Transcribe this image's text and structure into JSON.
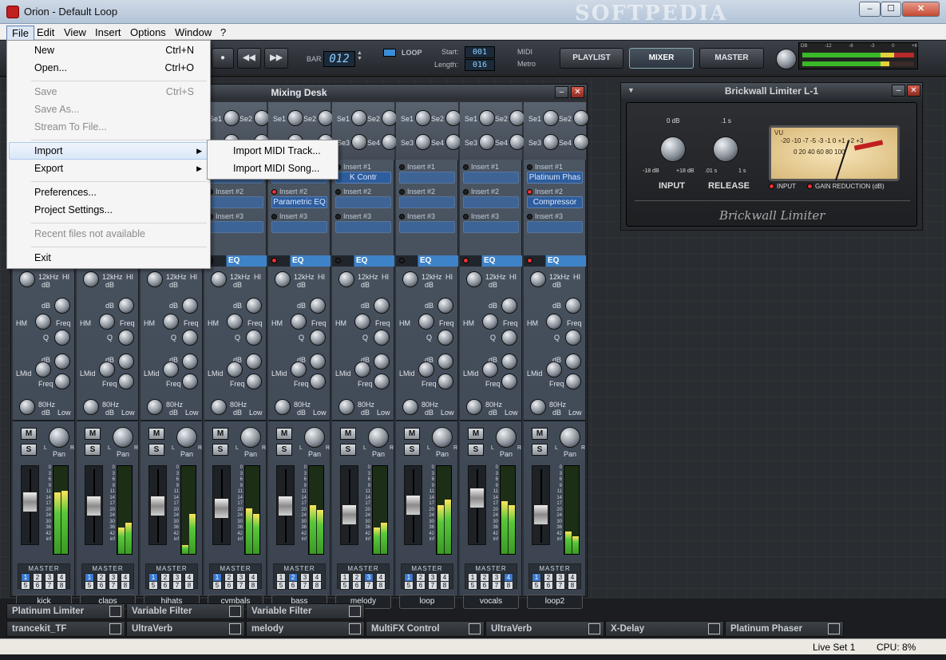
{
  "window": {
    "title": "Orion - Default Loop",
    "watermark": "SOFTPEDIA"
  },
  "menubar": [
    "File",
    "Edit",
    "View",
    "Insert",
    "Options",
    "Window",
    "?"
  ],
  "file_menu": {
    "new": "New",
    "new_sc": "Ctrl+N",
    "open": "Open...",
    "open_sc": "Ctrl+O",
    "save": "Save",
    "save_sc": "Ctrl+S",
    "save_as": "Save As...",
    "stream": "Stream To File...",
    "import": "Import",
    "export": "Export",
    "preferences": "Preferences...",
    "project_settings": "Project Settings...",
    "recent": "Recent files not available",
    "exit": "Exit"
  },
  "import_menu": {
    "midi_track": "Import MIDI Track...",
    "midi_song": "Import MIDI Song..."
  },
  "transport": {
    "bar_label": "BAR",
    "bar_value": "012",
    "loop_label": "LOOP",
    "start_label": "Start:",
    "start_value": "001",
    "length_label": "Length:",
    "length_value": "016",
    "midi": "MIDI",
    "metro": "Metro",
    "playlist": "PLAYLIST",
    "mixer": "MIXER",
    "master": "MASTER",
    "db_scale": [
      "DB",
      "-12",
      "-6",
      "-3",
      "0",
      "+6"
    ]
  },
  "mixing_desk": {
    "title": "Mixing Desk",
    "sends": [
      "Se1",
      "Se2",
      "Se3",
      "Se4"
    ],
    "insert_labels": [
      "Insert #1",
      "Insert #2",
      "Insert #3"
    ],
    "eq_label": "EQ",
    "eq_labels": {
      "hi": "12kHz",
      "hi2": "HI",
      "db": "dB",
      "hm": "HM",
      "freq": "Freq",
      "q": "Q",
      "lmid": "LMid",
      "low": "80Hz",
      "low2": "Low"
    },
    "mute": "M",
    "solo": "S",
    "pan": "Pan",
    "pan_l": "L",
    "pan_r": "R",
    "meter_scale": [
      "0",
      "3",
      "6",
      "9",
      "11",
      "14",
      "17",
      "20",
      "24",
      "30",
      "36",
      "42",
      "inf"
    ],
    "master_label": "MASTER",
    "route_buttons": [
      "1",
      "2",
      "3",
      "4",
      "5",
      "6",
      "7",
      "8"
    ],
    "channels": [
      {
        "name": "kick",
        "insert1": "",
        "insert2": "",
        "insert3": "",
        "eq_led": false,
        "route": "1",
        "fader": 0.55,
        "meter_l": 0.7,
        "meter_r": 0.72
      },
      {
        "name": "claps",
        "insert1": "",
        "insert2": "",
        "insert3": "",
        "eq_led": false,
        "route": "1",
        "fader": 0.48,
        "meter_l": 0.3,
        "meter_r": 0.35
      },
      {
        "name": "hihats",
        "insert1": "",
        "insert2": "",
        "insert3": "",
        "eq_led": false,
        "route": "1",
        "fader": 0.48,
        "meter_l": 0.1,
        "meter_r": 0.45
      },
      {
        "name": "cymbals",
        "insert1": "",
        "insert2": "",
        "insert3": "",
        "eq_led": false,
        "route": "1",
        "fader": 0.45,
        "meter_l": 0.52,
        "meter_r": 0.45
      },
      {
        "name": "bass",
        "insert1": "",
        "insert2": "Parametric EQ",
        "insert3": "",
        "eq_led": true,
        "route": "2",
        "fader": 0.48,
        "meter_l": 0.55,
        "meter_r": 0.5
      },
      {
        "name": "melody",
        "insert1": "K Contr",
        "insert2": "",
        "insert3": "",
        "eq_led": false,
        "route": "3",
        "fader": 0.33,
        "meter_l": 0.3,
        "meter_r": 0.35
      },
      {
        "name": "loop",
        "insert1": "",
        "insert2": "",
        "insert3": "",
        "eq_led": false,
        "route": "1",
        "fader": 0.5,
        "meter_l": 0.55,
        "meter_r": 0.62
      },
      {
        "name": "vocals",
        "insert1": "",
        "insert2": "",
        "insert3": "",
        "eq_led": true,
        "route": "4",
        "fader": 0.62,
        "meter_l": 0.6,
        "meter_r": 0.55
      },
      {
        "name": "loop2",
        "insert1": "Platinum Phas",
        "insert2": "Compressor",
        "insert3": "",
        "eq_led": true,
        "route": "1",
        "fader": 0.33,
        "meter_l": 0.25,
        "meter_r": 0.2
      }
    ]
  },
  "brickwall": {
    "title": "Brickwall Limiter L-1",
    "input_db": "0 dB",
    "input_min": "-18 dB",
    "input_max": "+18 dB",
    "input_label": "INPUT",
    "release_top": ".1 s",
    "release_min": ".01 s",
    "release_max": "1 s",
    "release_label": "RELEASE",
    "vu": "VU",
    "vu_scale": "-20 -10 -7 -5 -3 -1 0 +1 +2 +3",
    "vu_pct": "0 20 40 60 80 100",
    "led_input": "INPUT",
    "led_gr": "GAIN REDUCTION (dB)",
    "brand": "Brickwall Limiter"
  },
  "tabs_row1": [
    "Platinum Limiter",
    "Variable Filter",
    "Variable Filter"
  ],
  "tabs_row2": [
    "trancekit_TF",
    "UltraVerb",
    "melody",
    "MultiFX Control",
    "UltraVerb",
    "X-Delay",
    "Platinum Phaser"
  ],
  "status": {
    "liveset": "Live Set 1",
    "cpu": "CPU: 8%"
  },
  "colors": {
    "accent": "#3a78d0",
    "insert": "#2e5d9e",
    "meter": "#58c83a",
    "led": "#e33333"
  }
}
